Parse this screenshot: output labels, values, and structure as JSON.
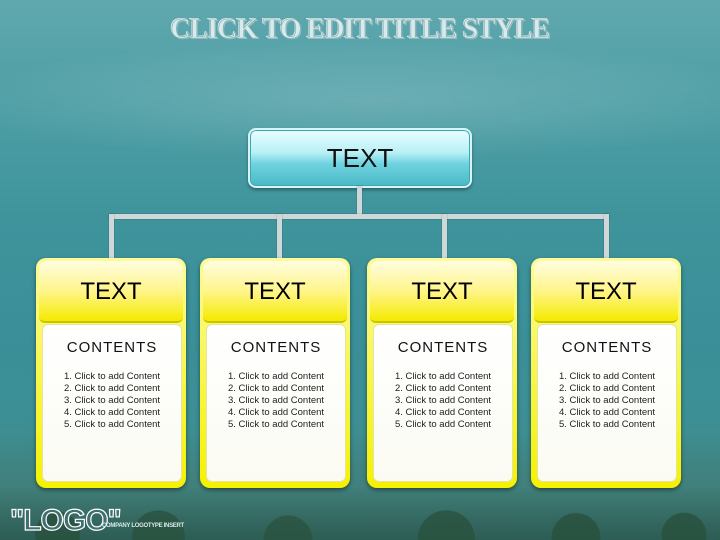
{
  "slide": {
    "title": "CLICK TO EDIT TITLE STYLE",
    "root_label": "TEXT",
    "cards": [
      {
        "header": "TEXT",
        "contents_label": "CONTENTS",
        "items": [
          "1. Click to add Content",
          "2. Click to add Content",
          "3. Click to add Content",
          "4. Click to add Content",
          "5. Click to add Content"
        ]
      },
      {
        "header": "TEXT",
        "contents_label": "CONTENTS",
        "items": [
          "1. Click to add Content",
          "2. Click to add Content",
          "3. Click to add Content",
          "4. Click to add Content",
          "5. Click to add Content"
        ]
      },
      {
        "header": "TEXT",
        "contents_label": "CONTENTS",
        "items": [
          "1. Click to add Content",
          "2. Click to add Content",
          "3. Click to add Content",
          "4. Click to add Content",
          "5. Click to add Content"
        ]
      },
      {
        "header": "TEXT",
        "contents_label": "CONTENTS",
        "items": [
          "1. Click to add Content",
          "2. Click to add Content",
          "3. Click to add Content",
          "4. Click to add Content",
          "5. Click to add Content"
        ]
      }
    ],
    "logo": "\"LOGO\"",
    "company_logotype": "COMPANY LOGOTYPE INSERT"
  },
  "colors": {
    "background": "#3f949c",
    "root_box": "#6fd3df",
    "card_yellow": "#f6f100",
    "connector": "#cfd7d8"
  }
}
